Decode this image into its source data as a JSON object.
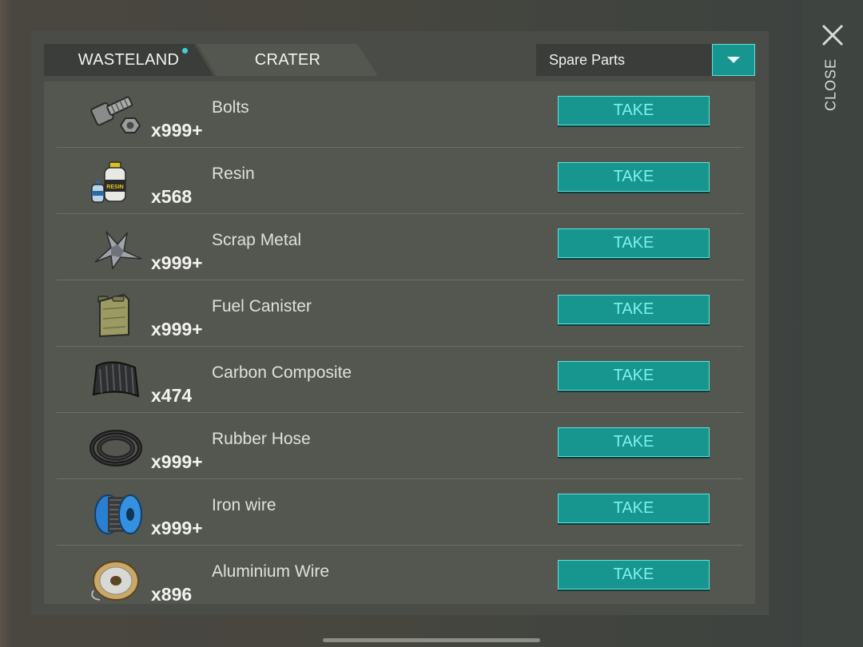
{
  "tabs": [
    {
      "label": "WASTELAND",
      "active": true,
      "has_notification": true
    },
    {
      "label": "CRATER",
      "active": false
    }
  ],
  "filter": {
    "selected": "Spare Parts"
  },
  "close": {
    "label": "CLOSE"
  },
  "take_label": "TAKE",
  "items": [
    {
      "name": "Bolts",
      "qty": "x999+",
      "icon": "bolts-icon"
    },
    {
      "name": "Resin",
      "qty": "x568",
      "icon": "resin-icon"
    },
    {
      "name": "Scrap Metal",
      "qty": "x999+",
      "icon": "scrap-metal-icon"
    },
    {
      "name": "Fuel Canister",
      "qty": "x999+",
      "icon": "fuel-canister-icon"
    },
    {
      "name": "Carbon Composite",
      "qty": "x474",
      "icon": "carbon-composite-icon"
    },
    {
      "name": "Rubber Hose",
      "qty": "x999+",
      "icon": "rubber-hose-icon"
    },
    {
      "name": "Iron wire",
      "qty": "x999+",
      "icon": "iron-wire-icon"
    },
    {
      "name": "Aluminium Wire",
      "qty": "x896",
      "icon": "aluminium-wire-icon"
    }
  ],
  "colors": {
    "accent": "#17958f",
    "accent_border": "#5fe2dc",
    "panel": "#4a4c47",
    "list": "#545650"
  }
}
